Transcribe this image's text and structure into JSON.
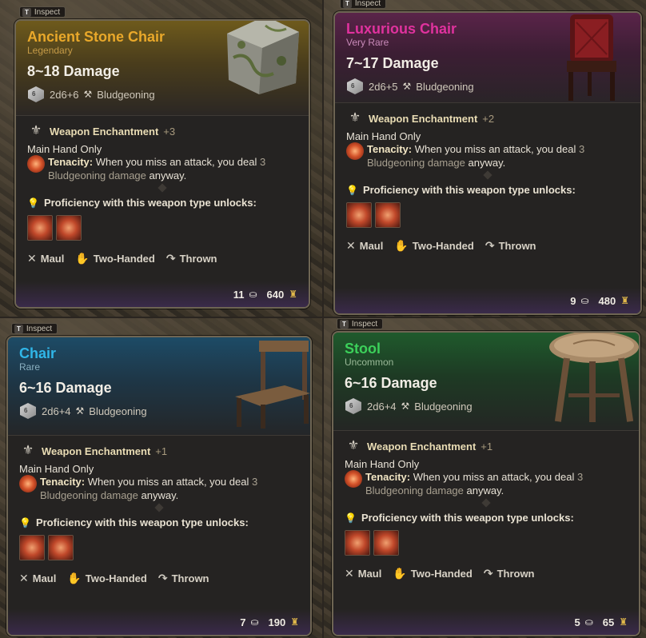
{
  "cards": [
    {
      "key": "ancient_stone_chair",
      "inspect_key": "T",
      "inspect_label": "Inspect",
      "name": "Ancient Stone Chair",
      "rarity": "Legendary",
      "name_color": "#e9a82a",
      "rarity_color": "#c49a48",
      "damage": "8~18 Damage",
      "dice": "2d6+6",
      "damage_type": "Bludgeoning",
      "enchant_label": "Weapon Enchantment",
      "enchant_value": "+3",
      "main_hand": "Main Hand Only",
      "tenacity_label": "Tenacity:",
      "tenacity_text_1": "When you miss an attack, you deal",
      "tenacity_num": "3",
      "tenacity_dmg": "Bludgeoning damage",
      "tenacity_tail": "anyway.",
      "prof_title": "Proficiency with this weapon type unlocks:",
      "tags": [
        "Maul",
        "Two-Handed",
        "Thrown"
      ],
      "weight": "11",
      "value": "640"
    },
    {
      "key": "luxurious_chair",
      "inspect_key": "T",
      "inspect_label": "Inspect",
      "name": "Luxurious Chair",
      "rarity": "Very Rare",
      "name_color": "#e0329e",
      "rarity_color": "#c88ab8",
      "damage": "7~17 Damage",
      "dice": "2d6+5",
      "damage_type": "Bludgeoning",
      "enchant_label": "Weapon Enchantment",
      "enchant_value": "+2",
      "main_hand": "Main Hand Only",
      "tenacity_label": "Tenacity:",
      "tenacity_text_1": "When you miss an attack, you deal",
      "tenacity_num": "3",
      "tenacity_dmg": "Bludgeoning damage",
      "tenacity_tail": "anyway.",
      "prof_title": "Proficiency with this weapon type unlocks:",
      "tags": [
        "Maul",
        "Two-Handed",
        "Thrown"
      ],
      "weight": "9",
      "value": "480"
    },
    {
      "key": "chair",
      "inspect_key": "T",
      "inspect_label": "Inspect",
      "name": "Chair",
      "rarity": "Rare",
      "name_color": "#30b6e8",
      "rarity_color": "#8ab0c0",
      "damage": "6~16 Damage",
      "dice": "2d6+4",
      "damage_type": "Bludgeoning",
      "enchant_label": "Weapon Enchantment",
      "enchant_value": "+1",
      "main_hand": "Main Hand Only",
      "tenacity_label": "Tenacity:",
      "tenacity_text_1": "When you miss an attack, you deal",
      "tenacity_num": "3",
      "tenacity_dmg": "Bludgeoning damage",
      "tenacity_tail": "anyway.",
      "prof_title": "Proficiency with this weapon type unlocks:",
      "tags": [
        "Maul",
        "Two-Handed",
        "Thrown"
      ],
      "weight": "7",
      "value": "190"
    },
    {
      "key": "stool",
      "inspect_key": "T",
      "inspect_label": "Inspect",
      "name": "Stool",
      "rarity": "Uncommon",
      "name_color": "#3cd05a",
      "rarity_color": "#9ab898",
      "damage": "6~16 Damage",
      "dice": "2d6+4",
      "damage_type": "Bludgeoning",
      "enchant_label": "Weapon Enchantment",
      "enchant_value": "+1",
      "main_hand": "Main Hand Only",
      "tenacity_label": "Tenacity:",
      "tenacity_text_1": "When you miss an attack, you deal",
      "tenacity_num": "3",
      "tenacity_dmg": "Bludgeoning damage",
      "tenacity_tail": "anyway.",
      "prof_title": "Proficiency with this weapon type unlocks:",
      "tags": [
        "Maul",
        "Two-Handed",
        "Thrown"
      ],
      "weight": "5",
      "value": "65"
    }
  ]
}
